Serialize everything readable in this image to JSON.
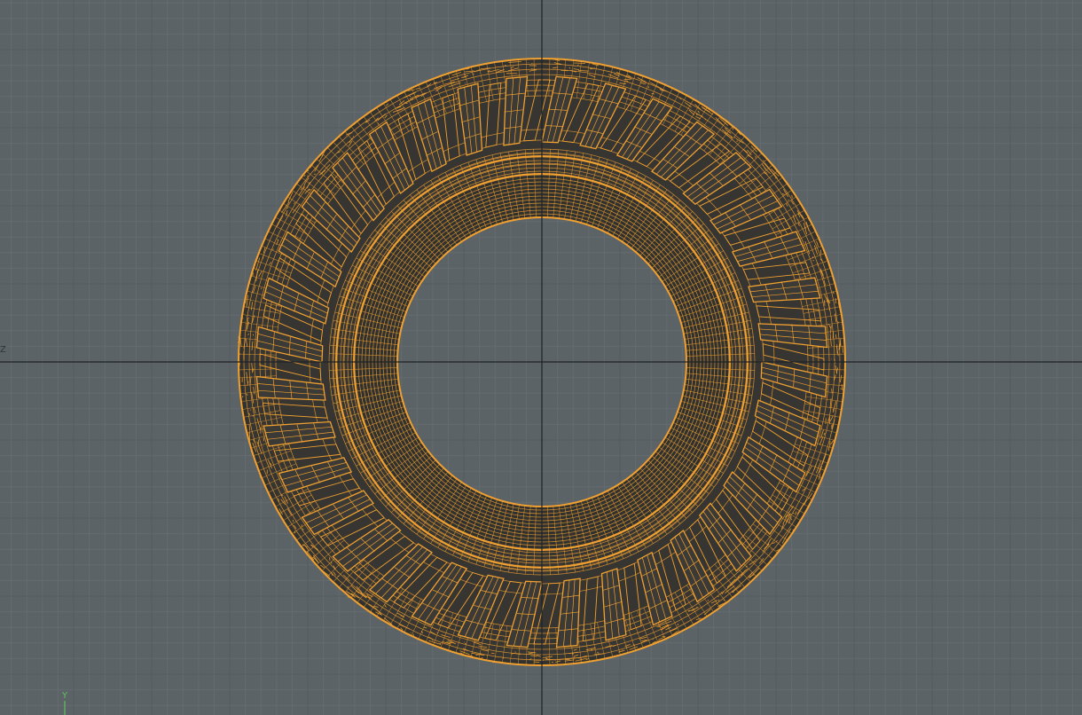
{
  "viewport": {
    "axis_labels": {
      "horizontal": "Z",
      "vertical": "Y"
    },
    "colors": {
      "background": "#5c6367",
      "grid_minor": "#646b6f",
      "grid_major": "#555b5f",
      "origin_axis": "#1f2326",
      "wireframe": "#f0a030",
      "tire_shade": "#2c2c2a",
      "vertical_axis_label": "#5fbf5f"
    },
    "model": {
      "name": "tire",
      "display_mode": "wireframe",
      "tread_blocks": 36
    }
  }
}
